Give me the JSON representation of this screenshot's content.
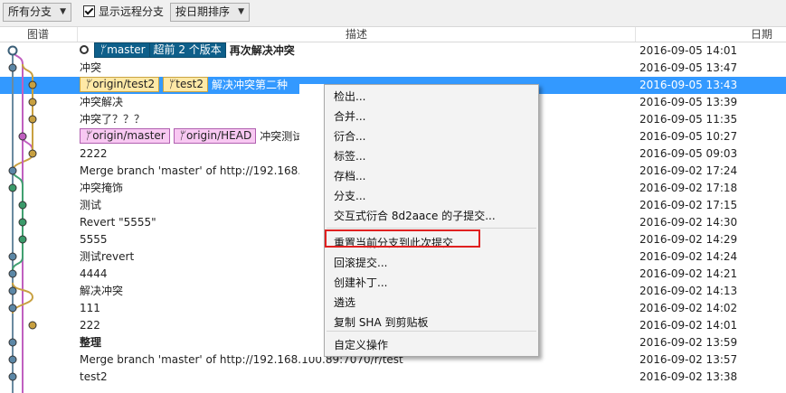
{
  "toolbar": {
    "branch_filter": "所有分支",
    "show_remote_label": "显示远程分支",
    "show_remote_checked": true,
    "sort_order": "按日期排序"
  },
  "columns": {
    "graph": "图谱",
    "description": "描述",
    "date": "日期"
  },
  "commits": [
    {
      "refs": [
        {
          "type": "local",
          "label": "master"
        }
      ],
      "ahead": "超前 2 个版本",
      "message": "再次解决冲突",
      "date": "2016-09-05 14:01",
      "head": true
    },
    {
      "refs": [],
      "message": "冲突",
      "date": "2016-09-05 13:47"
    },
    {
      "refs": [
        {
          "type": "remote",
          "label": "origin/test2"
        },
        {
          "type": "remote",
          "label": "test2"
        }
      ],
      "message": "解决冲突第二种",
      "date": "2016-09-05 13:43",
      "selected": true
    },
    {
      "refs": [],
      "message": "冲突解决",
      "date": "2016-09-05 13:39"
    },
    {
      "refs": [],
      "message": "冲突了？？？",
      "date": "2016-09-05 11:35"
    },
    {
      "refs": [
        {
          "type": "remote-pink",
          "label": "origin/master"
        },
        {
          "type": "remote-pink",
          "label": "origin/HEAD"
        }
      ],
      "message": "冲突测试",
      "date": "2016-09-05 10:27"
    },
    {
      "refs": [],
      "message": "2222",
      "date": "2016-09-05 09:03"
    },
    {
      "refs": [],
      "message": "Merge branch 'master' of http://192.168.1",
      "date": "2016-09-02 17:24"
    },
    {
      "refs": [],
      "message": "冲突掩饰",
      "date": "2016-09-02 17:18"
    },
    {
      "refs": [],
      "message": "测试",
      "date": "2016-09-02 17:15"
    },
    {
      "refs": [],
      "message": "Revert \"5555\"",
      "date": "2016-09-02 14:30"
    },
    {
      "refs": [],
      "message": "5555",
      "date": "2016-09-02 14:29"
    },
    {
      "refs": [],
      "message": "测试revert",
      "date": "2016-09-02 14:24"
    },
    {
      "refs": [],
      "message": "4444",
      "date": "2016-09-02 14:21"
    },
    {
      "refs": [],
      "message": "解决冲突",
      "date": "2016-09-02 14:13"
    },
    {
      "refs": [],
      "message": "111",
      "date": "2016-09-02 14:02"
    },
    {
      "refs": [],
      "message": "222",
      "date": "2016-09-02 14:01"
    },
    {
      "refs": [],
      "message": "整理",
      "date": "2016-09-02 13:59",
      "bold": true
    },
    {
      "refs": [],
      "message": "Merge branch 'master' of http://192.168.100.89:7070/r/test",
      "date": "2016-09-02 13:57"
    },
    {
      "refs": [],
      "message": "test2",
      "date": "2016-09-02 13:38"
    }
  ],
  "context_menu": {
    "items": [
      "检出...",
      "合并...",
      "衍合...",
      "标签...",
      "存档...",
      "分支...",
      "交互式衍合 8d2aace 的子提交...",
      "重置当前分支到此次提交",
      "回滚提交...",
      "创建补丁...",
      "遴选",
      "复制 SHA 到剪贴板",
      "自定义操作"
    ],
    "highlighted_index": 7
  },
  "colors": {
    "selection": "#3399ff",
    "local_branch": "#0e5f8a",
    "remote_yellow": "#ffe9a6",
    "remote_pink": "#f8c8f2",
    "highlight_box": "#e02020"
  }
}
